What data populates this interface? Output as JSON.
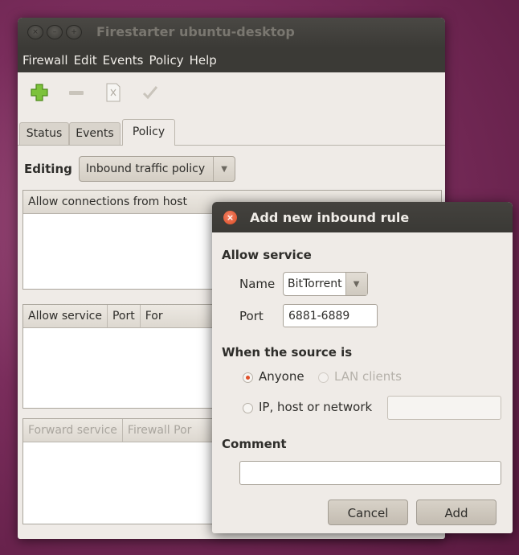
{
  "main_window": {
    "title": "Firestarter ubuntu-desktop",
    "menu": [
      "Firewall",
      "Edit",
      "Events",
      "Policy",
      "Help"
    ],
    "tabs": [
      "Status",
      "Events",
      "Policy"
    ],
    "editing_label": "Editing",
    "policy_select": "Inbound traffic policy",
    "hosts_header": "Allow connections from host",
    "services_headers": [
      "Allow service",
      "Port",
      "For"
    ],
    "forward_headers": [
      "Forward service",
      "Firewall Por"
    ]
  },
  "dialog": {
    "title": "Add new inbound rule",
    "allow_service_heading": "Allow service",
    "name_label": "Name",
    "name_value": "BitTorrent",
    "port_label": "Port",
    "port_value": "6881-6889",
    "source_heading": "When the source is",
    "source_options": [
      "Anyone",
      "LAN clients",
      "IP, host or network"
    ],
    "comment_heading": "Comment",
    "comment_value": "",
    "cancel_label": "Cancel",
    "add_label": "Add"
  },
  "colors": {
    "desktop_bg": "#7a2d5c",
    "titlebar": "#3b3a36",
    "radio_accent": "#e0502a",
    "close_button": "#d9491f"
  }
}
